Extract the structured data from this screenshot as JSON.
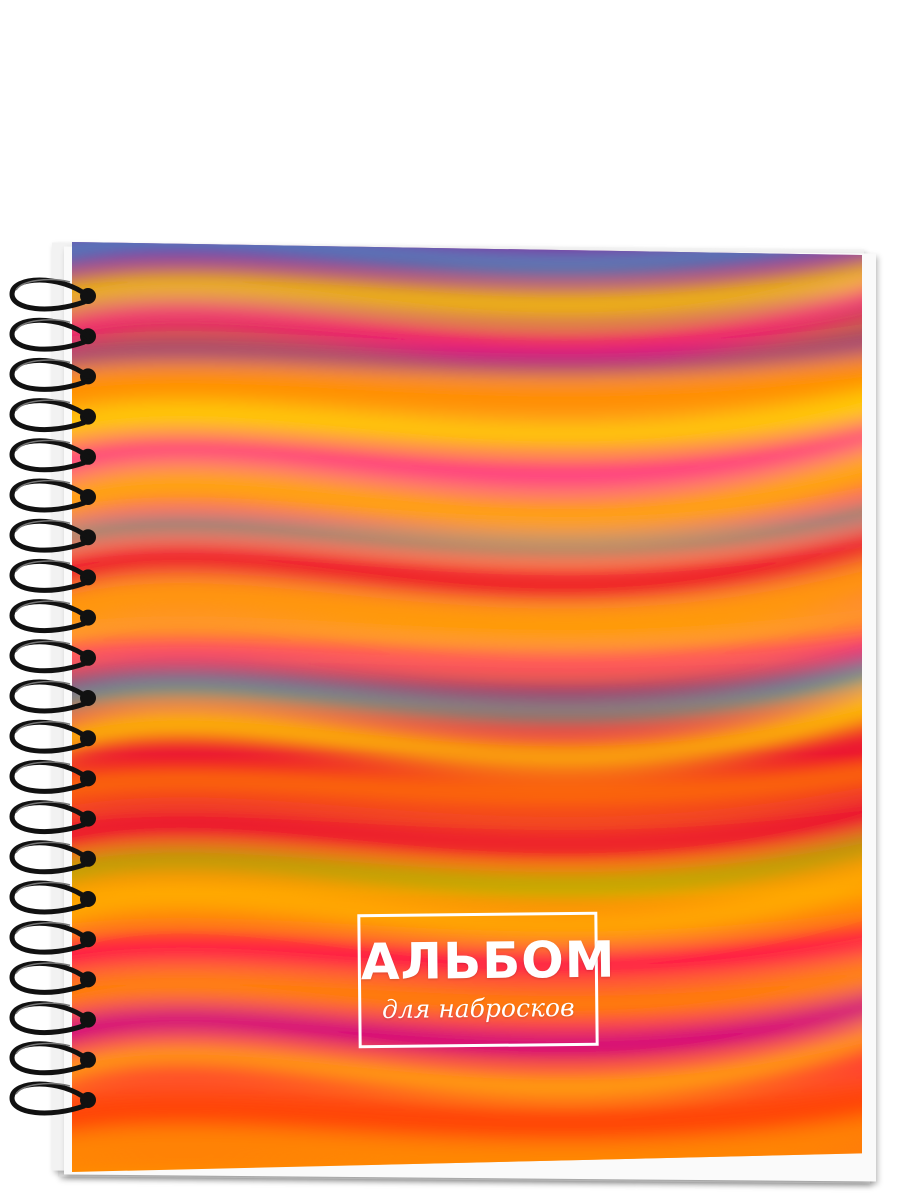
{
  "product": {
    "title": "АЛЬБОМ",
    "subtitle": "для набросков"
  },
  "cover": {
    "style": "rainbow-waves",
    "colors": [
      "#ff0080",
      "#ffd000",
      "#ff7a00",
      "#7a1fa2",
      "#00c0c0",
      "#e8001c",
      "#66cc00"
    ]
  },
  "binding": {
    "type": "spiral",
    "rings": 21,
    "color": "#111111"
  }
}
